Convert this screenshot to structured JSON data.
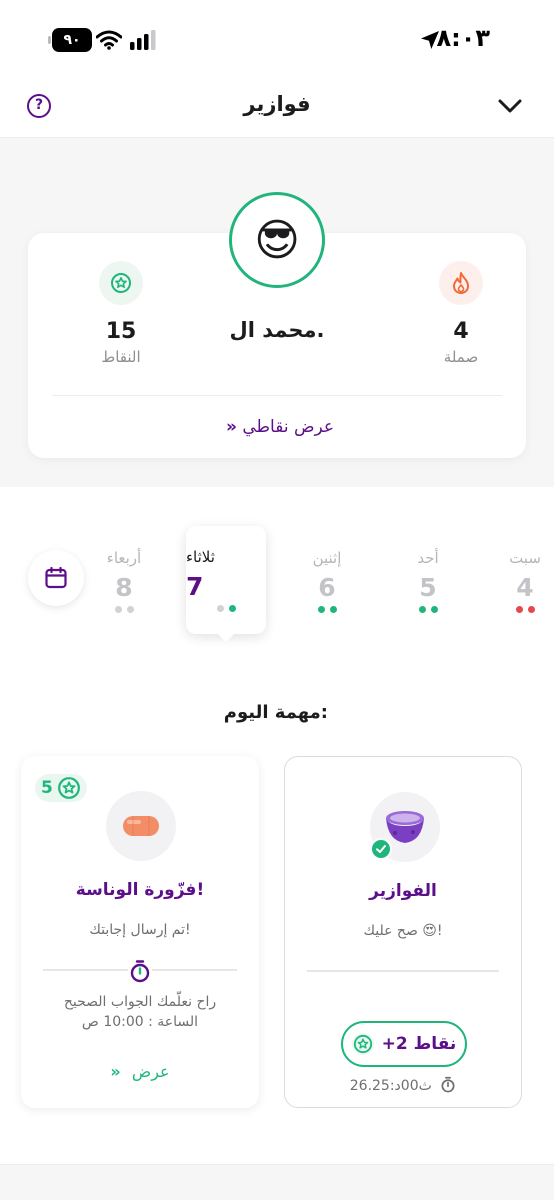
{
  "status_bar": {
    "time": "٨:٠٣",
    "battery": "٩٠"
  },
  "header": {
    "title": "فوازير"
  },
  "profile": {
    "avatar_emoji": "😎",
    "name": "محمد ال.",
    "points_value": "15",
    "points_label": "النقاط",
    "streak_value": "4",
    "streak_label": "صملة",
    "view_points_label": "عرض نقاطي",
    "view_points_chevron": "»"
  },
  "days": [
    {
      "name": "سبت",
      "num": "4",
      "dots": [
        "r",
        "r"
      ]
    },
    {
      "name": "أحد",
      "num": "5",
      "dots": [
        "g",
        "g"
      ]
    },
    {
      "name": "إثنين",
      "num": "6",
      "dots": [
        "g",
        "g"
      ]
    },
    {
      "name": "ثلاثاء",
      "num": "7",
      "dots": [
        "e",
        "g"
      ],
      "selected": true
    },
    {
      "name": "أربعاء",
      "num": "8",
      "dots": [
        "e",
        "e"
      ]
    }
  ],
  "task": {
    "title": "مهمة اليوم:",
    "left_card": {
      "points": "5",
      "title": "فزّورة الوناسة!",
      "subtitle": "تم إرسال إجابتك!",
      "note_line1": "راح نعلّمك الجواب الصحيح",
      "note_line2": "الساعة : 10:00 ص",
      "link_label": "عرض",
      "link_chevron": "»"
    },
    "right_card": {
      "title": "الفوازير",
      "subtitle": "صح عليك 😍!",
      "earn_label": "+2 نقاط",
      "elapsed": "26.25:ث00د"
    }
  },
  "colors": {
    "purple": "#5b0f8a",
    "green": "#1fb67c",
    "red": "#e5484d",
    "orange": "#f06a3a"
  },
  "icons": [
    "location-icon",
    "wifi-icon",
    "signal-icon",
    "help-icon",
    "chevron-down-icon",
    "star-badge-icon",
    "flame-icon",
    "calendar-icon",
    "sausage-icon",
    "bowl-icon",
    "check-icon",
    "timer-icon"
  ]
}
